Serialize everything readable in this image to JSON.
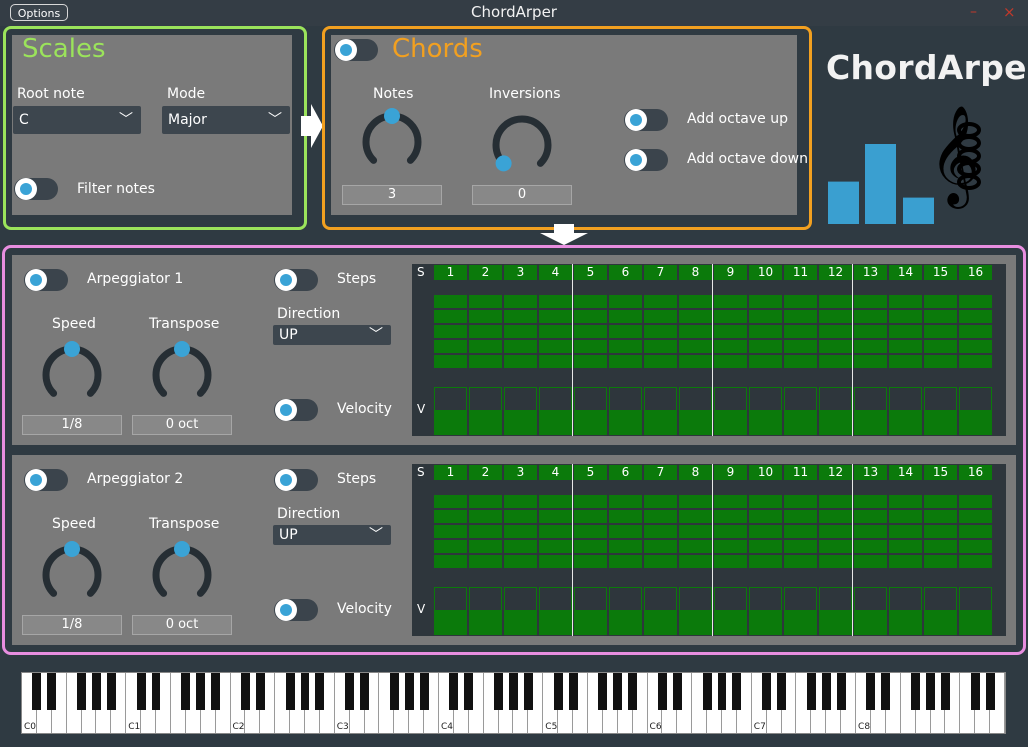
{
  "window": {
    "title": "ChordArper",
    "options_label": "Options",
    "minimize_glyph": "–",
    "close_glyph": "×"
  },
  "colors": {
    "background": "#2f3a42",
    "panel": "#7a7a7a",
    "scales_accent": "#9be35b",
    "chords_accent": "#f2a020",
    "arp_frame": "#e88ee0",
    "knob_indicator": "#3aa3d6",
    "step_on": "#0b7a0b",
    "logo_bars": "#3a9fd0"
  },
  "scales": {
    "title": "Scales",
    "root_note_label": "Root note",
    "root_note_value": "C",
    "mode_label": "Mode",
    "mode_value": "Major",
    "filter_notes_label": "Filter notes"
  },
  "chords": {
    "title": "Chords",
    "notes_label": "Notes",
    "notes_value": "3",
    "notes_level": 0.5,
    "inversions_label": "Inversions",
    "inversions_value": "0",
    "inversions_level": 0.0,
    "add_octave_up_label": "Add octave up",
    "add_octave_down_label": "Add octave down"
  },
  "logo": {
    "text": "ChordArper",
    "bar_levels": [
      0.53,
      1.0,
      0.33
    ],
    "icons": [
      "treble-clef-icon",
      "chord-stack-icon"
    ]
  },
  "arpeggiators": [
    {
      "title": "Arpeggiator 1",
      "speed_label": "Speed",
      "speed_value": "1/8",
      "speed_level": 0.5,
      "transpose_label": "Transpose",
      "transpose_value": "0 oct",
      "transpose_level": 0.5,
      "steps_label": "Steps",
      "direction_label": "Direction",
      "direction_value": "UP",
      "velocity_label": "Velocity"
    },
    {
      "title": "Arpeggiator 2",
      "speed_label": "Speed",
      "speed_value": "1/8",
      "speed_level": 0.5,
      "transpose_label": "Transpose",
      "transpose_value": "0 oct",
      "transpose_level": 0.5,
      "steps_label": "Steps",
      "direction_label": "Direction",
      "direction_value": "UP",
      "velocity_label": "Velocity"
    }
  ],
  "step_grid": {
    "steps_row_label": "S",
    "velocity_row_label": "V",
    "step_numbers": [
      "1",
      "2",
      "3",
      "4",
      "5",
      "6",
      "7",
      "8",
      "9",
      "10",
      "11",
      "12",
      "13",
      "14",
      "15",
      "16"
    ],
    "note_rows": 5,
    "velocity_level": 0.5
  },
  "keyboard": {
    "octave_labels": [
      "C0",
      "C1",
      "C2",
      "C3",
      "C4",
      "C5",
      "C6",
      "C7",
      "C8"
    ]
  }
}
